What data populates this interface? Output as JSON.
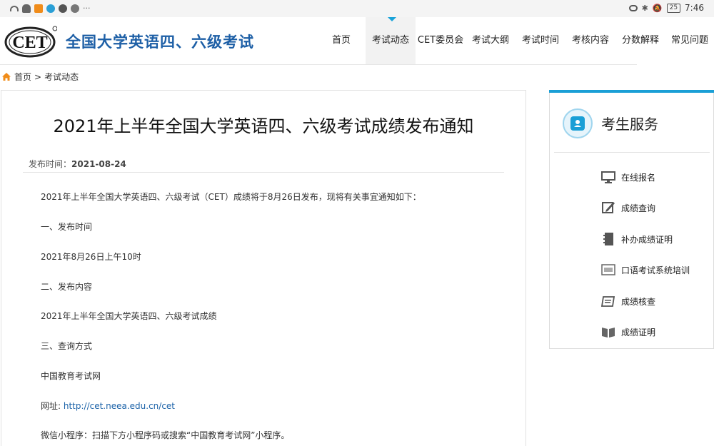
{
  "status_bar": {
    "time": "7:46",
    "battery": "25"
  },
  "header": {
    "logo_text": "CET",
    "site_title": "全国大学英语四、六级考试"
  },
  "nav": {
    "items": [
      {
        "label": "首页",
        "active": false
      },
      {
        "label": "考试动态",
        "active": true
      },
      {
        "label": "CET委员会",
        "active": false
      },
      {
        "label": "考试大纲",
        "active": false
      },
      {
        "label": "考试时间",
        "active": false
      },
      {
        "label": "考核内容",
        "active": false
      },
      {
        "label": "分数解释",
        "active": false
      },
      {
        "label": "常见问题",
        "active": false
      }
    ]
  },
  "breadcrumb": {
    "home": "首页",
    "separator": ">",
    "current": "考试动态"
  },
  "article": {
    "title": "2021年上半年全国大学英语四、六级考试成绩发布通知",
    "publish_label": "发布时间：",
    "publish_date": "2021-08-24",
    "paragraphs": [
      "2021年上半年全国大学英语四、六级考试（CET）成绩将于8月26日发布，现将有关事宜通知如下：",
      "一、发布时间",
      "2021年8月26日上午10时",
      "二、发布内容",
      "2021年上半年全国大学英语四、六级考试成绩",
      "三、查询方式",
      "中国教育考试网"
    ],
    "url_label": "网址: ",
    "url": "http://cet.neea.edu.cn/cet",
    "wechat": "微信小程序：扫描下方小程序码或搜索“中国教育考试网”小程序。"
  },
  "sidebar": {
    "title": "考生服务",
    "items": [
      {
        "label": "在线报名",
        "icon": "monitor-icon"
      },
      {
        "label": "成绩查询",
        "icon": "edit-icon"
      },
      {
        "label": "补办成绩证明",
        "icon": "notebook-icon"
      },
      {
        "label": "口语考试系统培训",
        "icon": "screen-icon"
      },
      {
        "label": "成绩核查",
        "icon": "certificate-icon"
      },
      {
        "label": "成绩证明",
        "icon": "book-icon"
      }
    ]
  },
  "colors": {
    "brand_blue": "#1d5fa6",
    "accent_cyan": "#1a9fd6",
    "link": "#1b62a8"
  }
}
